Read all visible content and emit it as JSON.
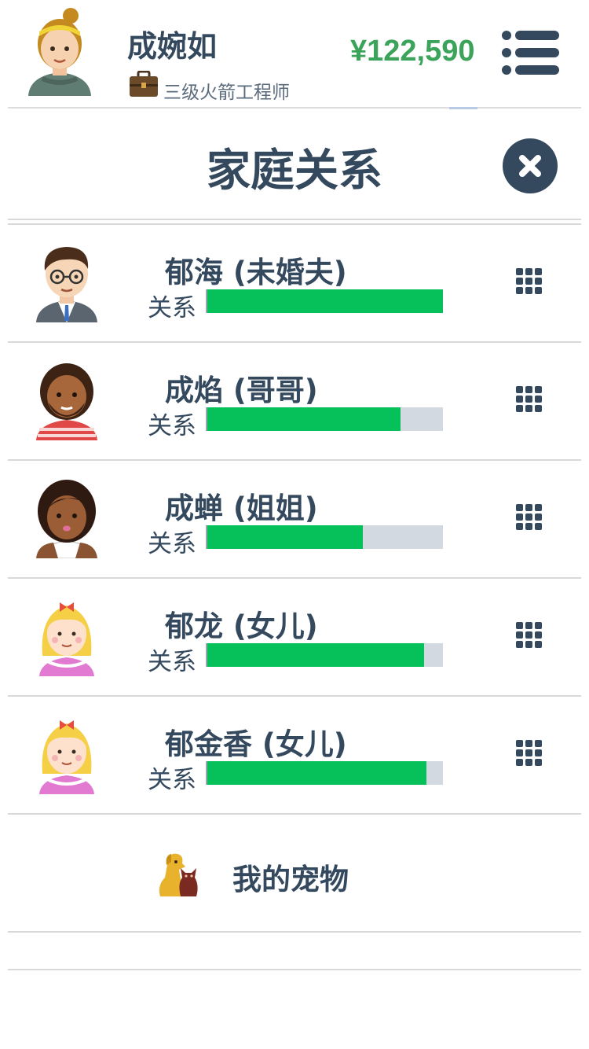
{
  "header": {
    "player_name": "成婉如",
    "job_title": "三级火箭工程师",
    "money": "¥122,590"
  },
  "page": {
    "title": "家庭关系"
  },
  "relation_label": "关系",
  "family": [
    {
      "name": "郁海 (未婚夫)",
      "relationship": 1.0
    },
    {
      "name": "成焰 (哥哥)",
      "relationship": 0.82
    },
    {
      "name": "成蝉 (姐姐)",
      "relationship": 0.66
    },
    {
      "name": "郁龙 (女儿)",
      "relationship": 0.92
    },
    {
      "name": "郁金香 (女儿)",
      "relationship": 0.93
    }
  ],
  "pets": {
    "label": "我的宠物"
  },
  "colors": {
    "text": "#34495e",
    "money": "#3ba35a",
    "bar_fill": "#06c05a",
    "bar_track": "#d2d9e0"
  },
  "icons": [
    "player-avatar",
    "briefcase-icon",
    "menu-icon",
    "close-icon",
    "grid-menu-icon",
    "pet-dog-cat-icon"
  ]
}
